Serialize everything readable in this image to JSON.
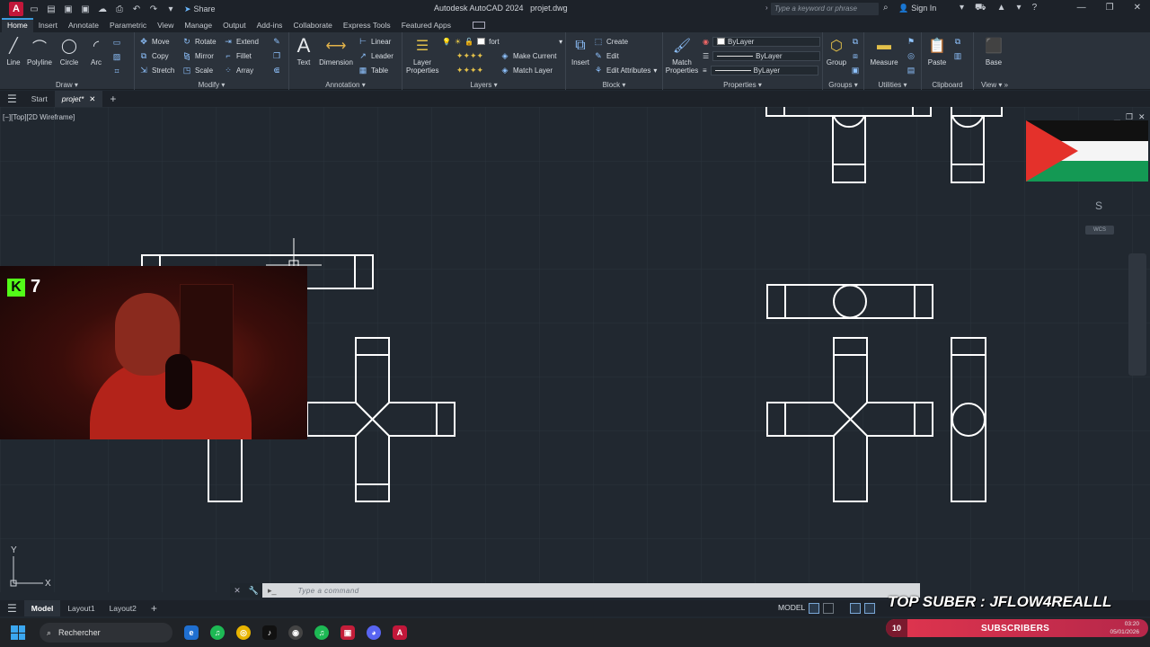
{
  "titlebar": {
    "app_title": "Autodesk AutoCAD 2024",
    "file_name": "projet.dwg",
    "share_label": "Share",
    "search_placeholder": "Type a keyword or phrase",
    "signin_label": "Sign In"
  },
  "ribbon_tabs": [
    "Home",
    "Insert",
    "Annotate",
    "Parametric",
    "View",
    "Manage",
    "Output",
    "Add-ins",
    "Collaborate",
    "Express Tools",
    "Featured Apps"
  ],
  "ribbon": {
    "draw": {
      "title": "Draw",
      "line": "Line",
      "polyline": "Polyline",
      "circle": "Circle",
      "arc": "Arc"
    },
    "modify": {
      "title": "Modify",
      "move": "Move",
      "rotate": "Rotate",
      "extend": "Extend",
      "copy": "Copy",
      "mirror": "Mirror",
      "fillet": "Fillet",
      "stretch": "Stretch",
      "scale": "Scale",
      "array": "Array"
    },
    "annotation": {
      "title": "Annotation",
      "text": "Text",
      "dimension": "Dimension",
      "linear": "Linear",
      "leader": "Leader",
      "table": "Table"
    },
    "layers": {
      "title": "Layers",
      "layer_properties_1": "Layer",
      "layer_properties_2": "Properties",
      "current_layer": "fort",
      "make_current": "Make Current",
      "match_layer": "Match Layer"
    },
    "block": {
      "title": "Block",
      "insert": "Insert",
      "create": "Create",
      "edit": "Edit",
      "edit_attributes": "Edit Attributes"
    },
    "properties": {
      "title": "Properties",
      "match_1": "Match",
      "match_2": "Properties",
      "color": "ByLayer",
      "linetype": "ByLayer",
      "lineweight": "ByLayer"
    },
    "groups": {
      "title": "Groups",
      "group": "Group"
    },
    "utilities": {
      "title": "Utilities",
      "measure": "Measure"
    },
    "clipboard": {
      "title": "Clipboard",
      "paste": "Paste"
    },
    "view": {
      "title": "View",
      "base": "Base"
    }
  },
  "file_tabs": {
    "start": "Start",
    "active": "projet*"
  },
  "viewport_label": "[−][Top][2D Wireframe]",
  "viewcube": {
    "compass_s": "S",
    "wcs": "WCS"
  },
  "ucs": {
    "y": "Y",
    "x": "X"
  },
  "command": {
    "placeholder": "Type a command"
  },
  "layout_tabs": [
    "Model",
    "Layout1",
    "Layout2"
  ],
  "status": {
    "model": "MODEL"
  },
  "overlay": {
    "kick_count": "7",
    "top_suber": "TOP SUBER : JFLOW4REALLL",
    "sub_count": "10",
    "sub_label": "SUBSCRIBERS"
  },
  "taskbar": {
    "search_label": "Rechercher",
    "time": "03:20",
    "date": "05/01/2026"
  },
  "colors": {
    "canvas_bg": "#212830",
    "ribbon_bg": "#2b323b",
    "accent": "#3c9de0",
    "kick_green": "#53fc18",
    "sub_bar": "#e0354e"
  }
}
